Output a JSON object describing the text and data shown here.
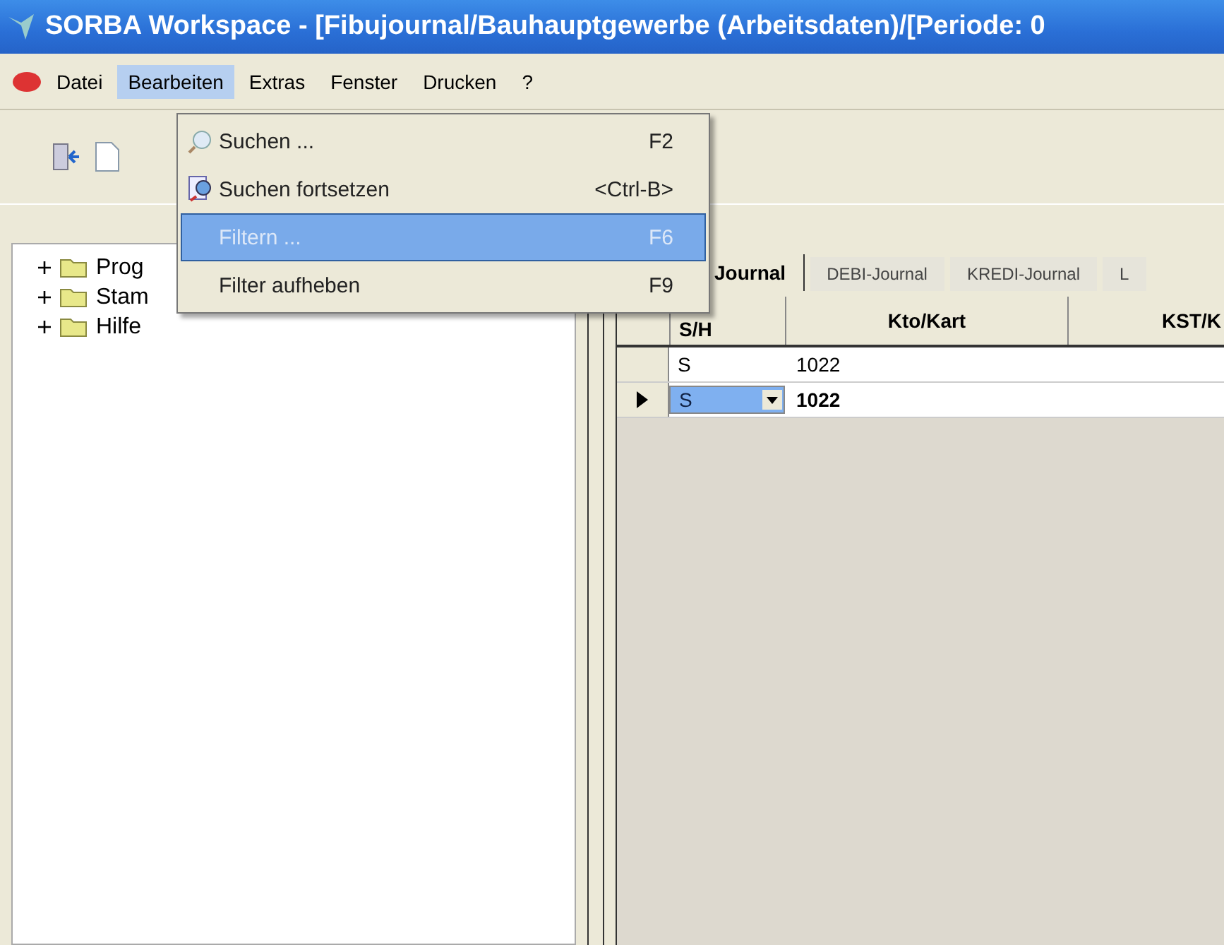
{
  "window": {
    "title": "SORBA Workspace - [Fibujournal/Bauhauptgewerbe (Arbeitsdaten)/[Periode: 0"
  },
  "menu_bar": [
    {
      "label": "Datei",
      "selected": false
    },
    {
      "label": "Bearbeiten",
      "selected": true
    },
    {
      "label": "Extras",
      "selected": false
    },
    {
      "label": "Fenster",
      "selected": false
    },
    {
      "label": "Drucken",
      "selected": false
    },
    {
      "label": "?",
      "selected": false
    }
  ],
  "dropdown": [
    {
      "label": "Suchen ...",
      "shortcut": "F2",
      "selected": false,
      "disabled": false
    },
    {
      "label": "Suchen fortsetzen",
      "shortcut": "<Ctrl-B>",
      "selected": false,
      "disabled": false
    },
    {
      "label": "Filtern ...",
      "shortcut": "F6",
      "selected": true,
      "disabled": true
    },
    {
      "label": "Filter aufheben",
      "shortcut": "F9",
      "selected": false,
      "disabled": false
    }
  ],
  "tree": [
    {
      "label": "Prog",
      "expanded": false
    },
    {
      "label": "Stam",
      "expanded": false
    },
    {
      "label": "Hilfe",
      "expanded": false
    }
  ],
  "tabs": [
    {
      "label": "Journal",
      "selected": true
    },
    {
      "label": "DEBI-Journal",
      "selected": false
    },
    {
      "label": "KREDI-Journal",
      "selected": false
    },
    {
      "label": "L",
      "selected": false
    }
  ],
  "table": {
    "columns": [
      "S/H",
      "Kto/Kart",
      "KST/K"
    ],
    "rows": [
      {
        "cells": [
          "S",
          "1022"
        ],
        "selected": false
      },
      {
        "cells": [
          "S",
          "1022"
        ],
        "selected": true
      }
    ]
  }
}
